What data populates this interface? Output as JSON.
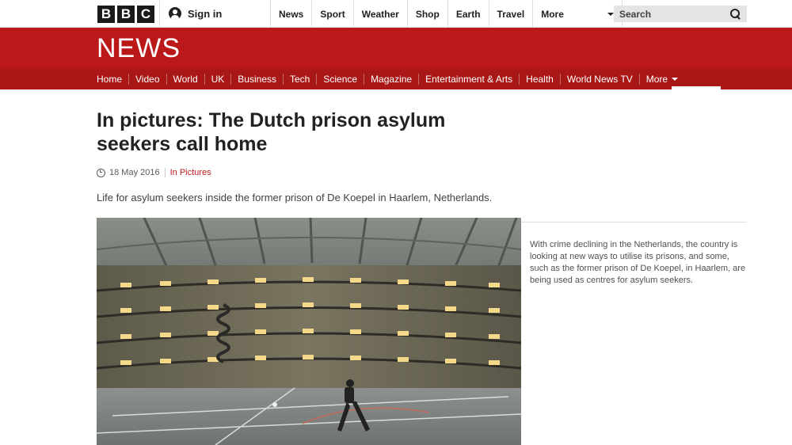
{
  "topbar": {
    "logo_letters": [
      "B",
      "B",
      "C"
    ],
    "signin_label": "Sign in",
    "nav": [
      "News",
      "Sport",
      "Weather",
      "Shop",
      "Earth",
      "Travel"
    ],
    "more_label": "More",
    "search_label": "Search"
  },
  "header": {
    "title": "NEWS",
    "subnav": [
      "Home",
      "Video",
      "World",
      "UK",
      "Business",
      "Tech",
      "Science",
      "Magazine",
      "Entertainment & Arts",
      "Health",
      "World News TV"
    ],
    "more_label": "More"
  },
  "article": {
    "headline": "In pictures: The Dutch prison asylum seekers call home",
    "date": "18 May 2016",
    "section": "In Pictures",
    "summary": "Life for asylum seekers inside the former prison of De Koepel in Haarlem, Netherlands.",
    "caption": "With crime declining in the Netherlands, the country is looking at new ways to utilise its prisons, and some, such as the former prison of De Koepel, in Haarlem, are being used as centres for asylum seekers."
  },
  "colors": {
    "brand_red": "#bb1919",
    "subnav_red": "#a91717"
  }
}
